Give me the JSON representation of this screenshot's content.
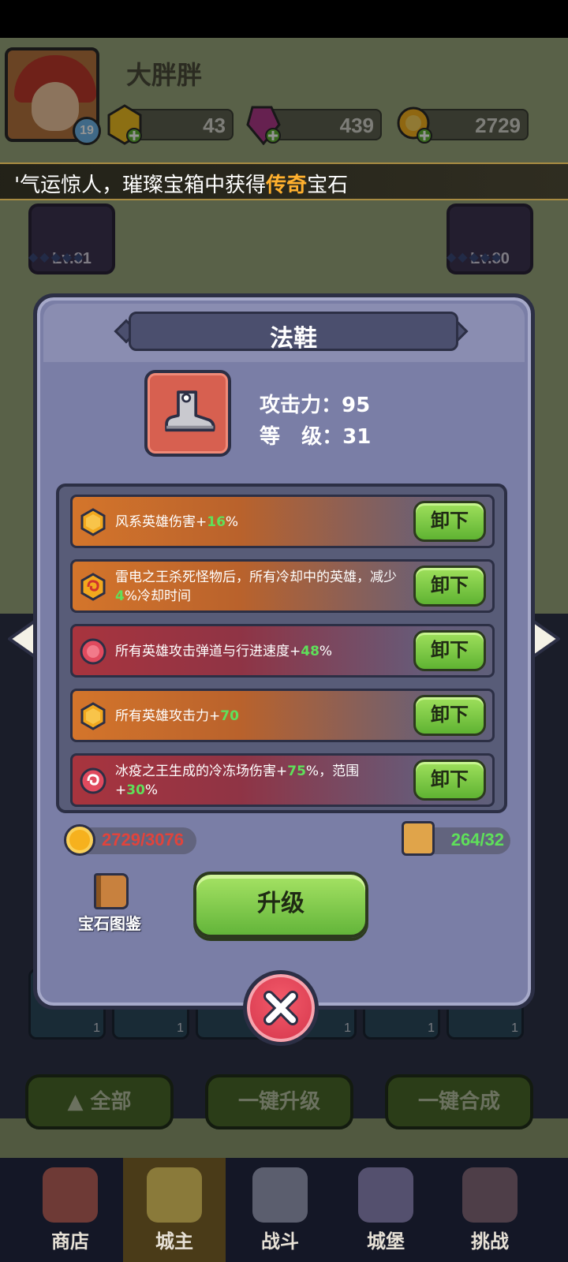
{
  "player": {
    "name": "大胖胖",
    "level": "19"
  },
  "resources": [
    {
      "name": "gold-gem",
      "value": "43"
    },
    {
      "name": "purple-crystal",
      "value": "439"
    },
    {
      "name": "coin",
      "value": "2729"
    }
  ],
  "ticker": {
    "prefix": "'气运惊人，璀璨宝箱中获得",
    "highlight": "传奇",
    "suffix": "宝石"
  },
  "side_slots": {
    "left_level": "Lv.31",
    "right_level": "Lv.30"
  },
  "dialog": {
    "title": "法鞋",
    "attack_label": "攻击力：",
    "attack_value": "95",
    "level_label": "等   级：",
    "level_value": "31",
    "gems": [
      {
        "type": "orange",
        "icon": "hexagon-gem-icon",
        "text_a": "风系英雄伤害+",
        "num": "16",
        "text_b": "%",
        "text_c": "",
        "num2": "",
        "text_d": "",
        "button": "卸下"
      },
      {
        "type": "orange",
        "icon": "swirl-gem-icon",
        "text_a": "雷电之王杀死怪物后，所有冷却中的英雄，减少",
        "num": "4",
        "text_b": "%冷却时间",
        "text_c": "",
        "num2": "",
        "text_d": "",
        "button": "卸下"
      },
      {
        "type": "red",
        "icon": "round-ruby-icon",
        "text_a": "所有英雄攻击弹道与行进速度+",
        "num": "48",
        "text_b": "%",
        "text_c": "",
        "num2": "",
        "text_d": "",
        "button": "卸下"
      },
      {
        "type": "orange",
        "icon": "hexagon-gem-icon",
        "text_a": "所有英雄攻击力+",
        "num": "70",
        "text_b": "",
        "text_c": "",
        "num2": "",
        "text_d": "",
        "button": "卸下"
      },
      {
        "type": "red",
        "icon": "swirl-ruby-icon",
        "text_a": "冰疫之王生成的冷冻场伤害+",
        "num": "75",
        "text_b": "%，范围+",
        "text_c": "",
        "num2": "30",
        "text_d": "%",
        "button": "卸下"
      }
    ],
    "coin_cost": "2729/3076",
    "scroll_cost": "264/32",
    "book_label": "宝石图鉴",
    "upgrade_label": "升级"
  },
  "grid_counts": [
    "1",
    "1",
    "1",
    "1",
    "1",
    "1"
  ],
  "actions": {
    "all": "全部",
    "upgrade_all": "一键升级",
    "merge_all": "一键合成"
  },
  "tabs": [
    {
      "label": "商店",
      "icon": "shop-icon"
    },
    {
      "label": "城主",
      "icon": "crown-icon"
    },
    {
      "label": "战斗",
      "icon": "swords-icon"
    },
    {
      "label": "城堡",
      "icon": "castle-icon"
    },
    {
      "label": "挑战",
      "icon": "demon-icon"
    }
  ],
  "colors": {
    "dialog_bg": "#7a7ea6",
    "green_value": "#5fe05a",
    "red_value": "#e0443c",
    "highlight": "#ffb02e"
  }
}
